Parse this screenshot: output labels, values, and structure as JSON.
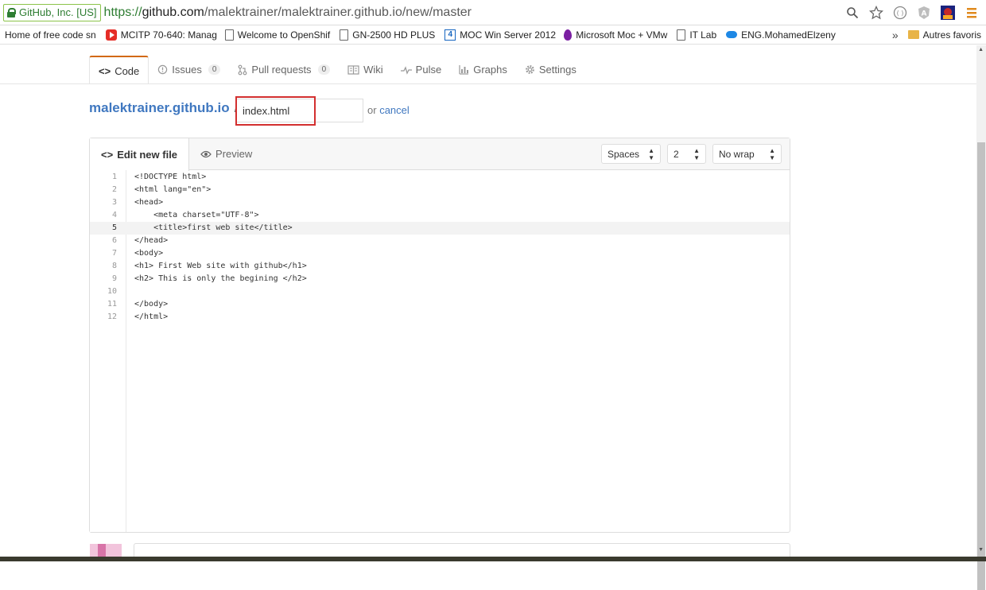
{
  "browser": {
    "security_badge": "GitHub, Inc. [US]",
    "url_proto": "https://",
    "url_host": "github.com",
    "url_path": "/malektrainer/malektrainer.github.io/new/master"
  },
  "bookmarks": {
    "items": [
      {
        "label": "Home of free code sn",
        "icon": "page-icon"
      },
      {
        "label": "MCITP 70-640: Manag",
        "icon": "youtube-icon"
      },
      {
        "label": "Welcome to OpenShif",
        "icon": "page-icon"
      },
      {
        "label": "GN-2500 HD PLUS",
        "icon": "page-icon"
      },
      {
        "label": "MOC Win Server 2012",
        "icon": "four-icon"
      },
      {
        "label": "Microsoft Moc + VMw",
        "icon": "drop-icon"
      },
      {
        "label": "IT Lab",
        "icon": "page-icon"
      },
      {
        "label": "ENG.MohamedElzeny",
        "icon": "cloud-icon"
      }
    ],
    "more": "»",
    "other_folder": "Autres favoris"
  },
  "repo_tabs": {
    "code": "Code",
    "issues": "Issues",
    "issues_count": "0",
    "pulls": "Pull requests",
    "pulls_count": "0",
    "wiki": "Wiki",
    "pulse": "Pulse",
    "graphs": "Graphs",
    "settings": "Settings"
  },
  "breadcrumb": {
    "repo": "malektrainer.github.io",
    "separator": "/",
    "filename_value": "index.html",
    "or_text": "or",
    "cancel": "cancel"
  },
  "editor": {
    "tab_edit": "Edit new file",
    "tab_preview": "Preview",
    "indent_mode": "Spaces",
    "indent_size": "2",
    "wrap_mode": "No wrap",
    "lines": [
      {
        "n": "1",
        "text": "<!DOCTYPE html>"
      },
      {
        "n": "2",
        "text": "<html lang=\"en\">"
      },
      {
        "n": "3",
        "text": "<head>"
      },
      {
        "n": "4",
        "text": "    <meta charset=\"UTF-8\">"
      },
      {
        "n": "5",
        "text": "    <title>first web site</title>"
      },
      {
        "n": "6",
        "text": "</head>"
      },
      {
        "n": "7",
        "text": "<body>"
      },
      {
        "n": "8",
        "text": "<h1> First Web site with github</h1>"
      },
      {
        "n": "9",
        "text": "<h2> This is only the begining </h2>"
      },
      {
        "n": "10",
        "text": ""
      },
      {
        "n": "11",
        "text": "</body>"
      },
      {
        "n": "12",
        "text": "</html>"
      }
    ],
    "current_line": 5
  }
}
